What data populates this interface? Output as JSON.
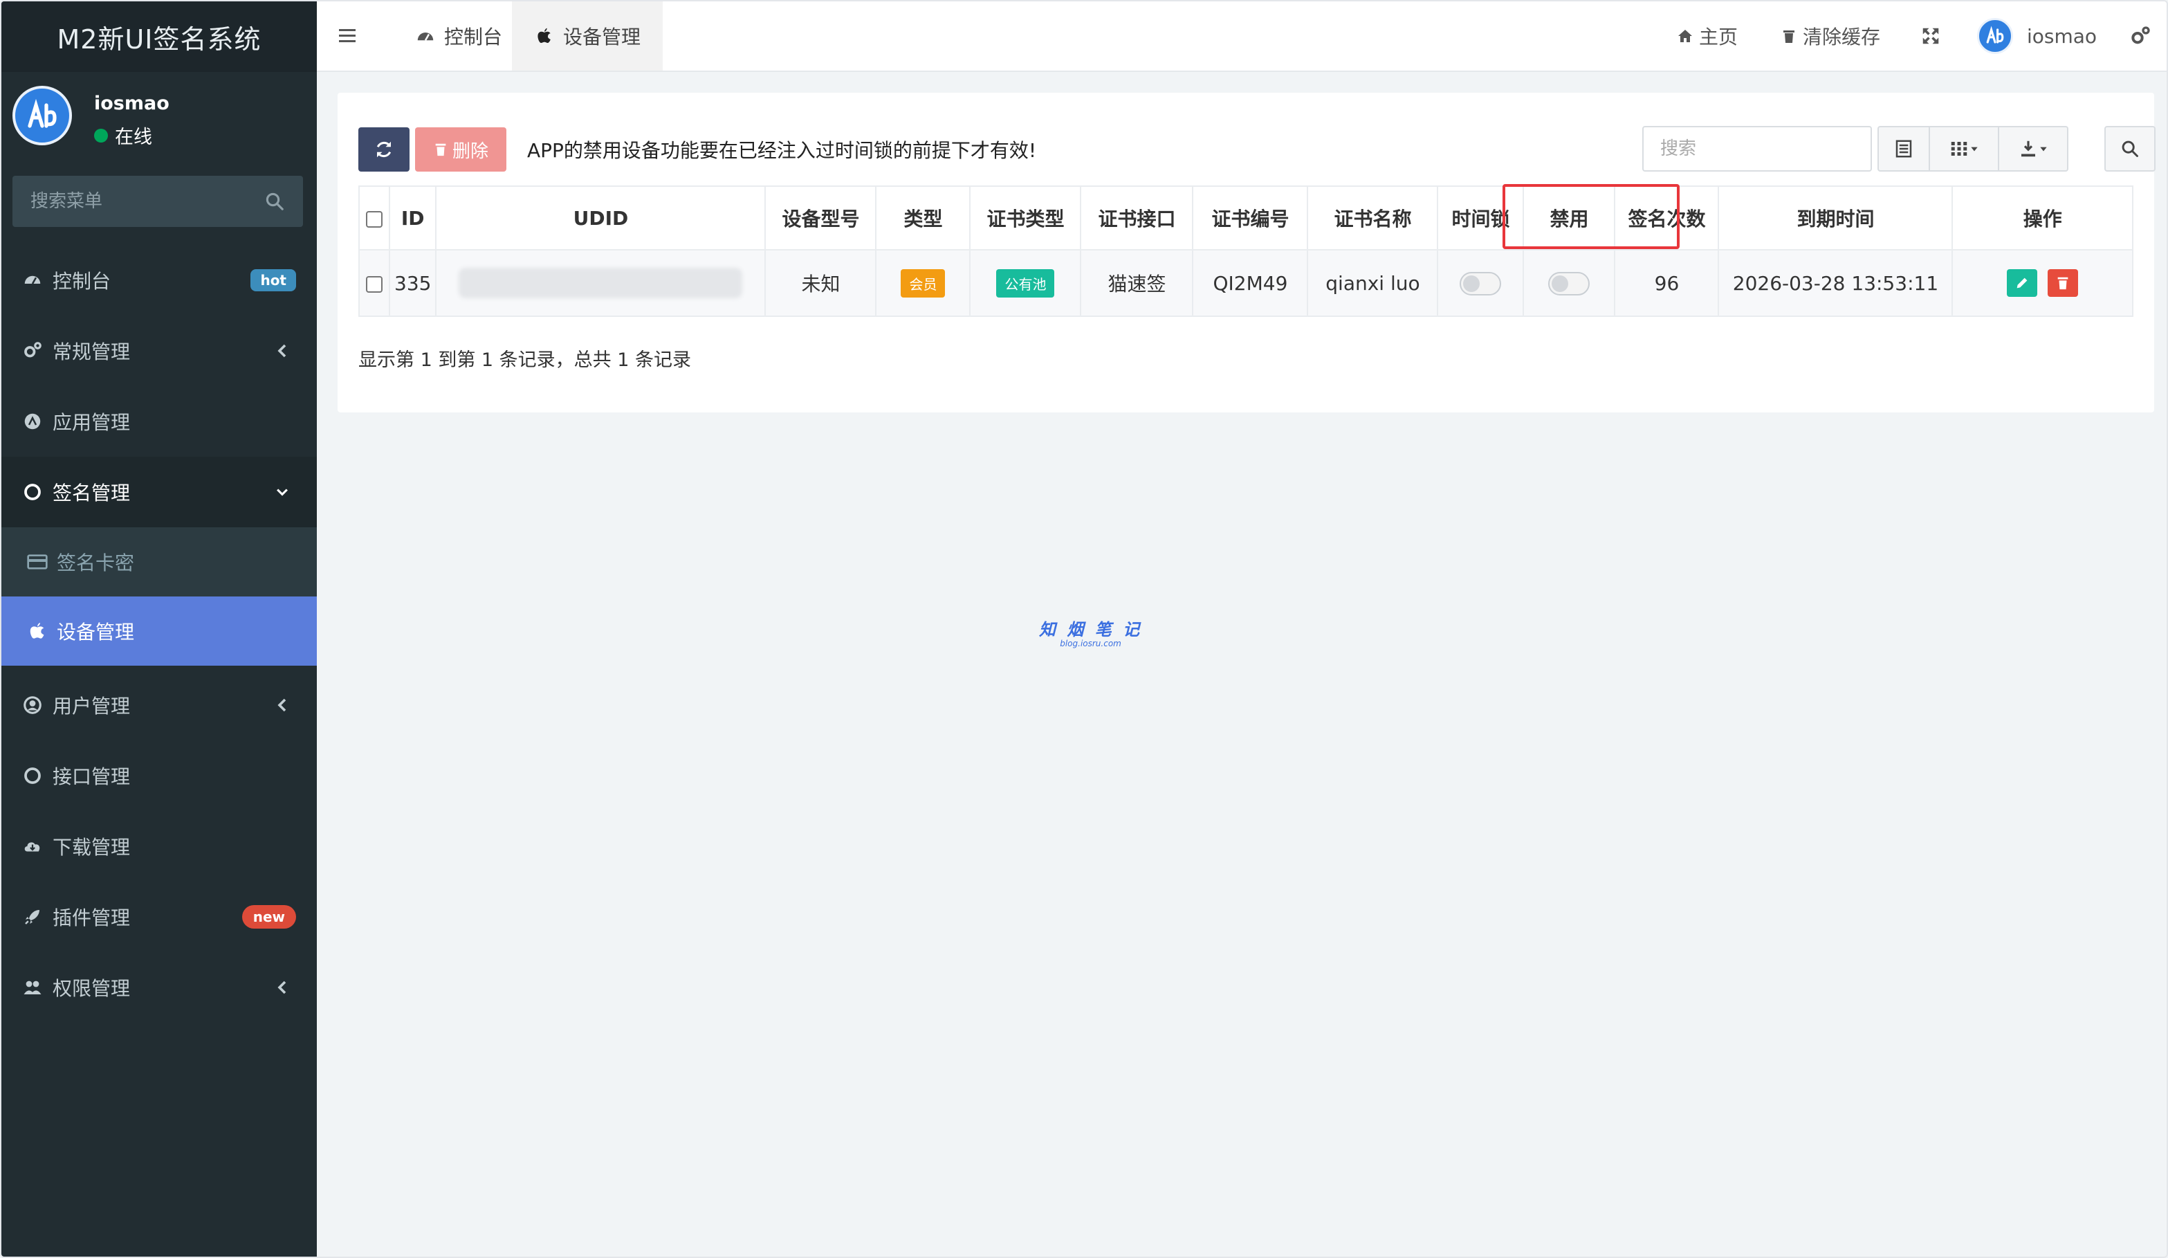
{
  "brand": "M2新UI签名系统",
  "user": {
    "name": "iosmao",
    "status": "在线"
  },
  "sidebar": {
    "search_placeholder": "搜索菜单",
    "items": [
      {
        "label": "控制台",
        "icon": "dashboard-icon",
        "badge": "hot"
      },
      {
        "label": "常规管理",
        "icon": "cogs-icon"
      },
      {
        "label": "应用管理",
        "icon": "app-store-icon"
      },
      {
        "label": "签名管理",
        "icon": "circle-icon"
      },
      {
        "label": "签名卡密",
        "icon": "credit-card-icon"
      },
      {
        "label": "设备管理",
        "icon": "apple-icon"
      },
      {
        "label": "用户管理",
        "icon": "user-circle-icon"
      },
      {
        "label": "接口管理",
        "icon": "circle-icon"
      },
      {
        "label": "下载管理",
        "icon": "cloud-download-icon"
      },
      {
        "label": "插件管理",
        "icon": "rocket-icon",
        "badge": "new"
      },
      {
        "label": "权限管理",
        "icon": "users-icon"
      }
    ]
  },
  "topbar": {
    "tabs": [
      {
        "label": "控制台",
        "icon": "dashboard-icon"
      },
      {
        "label": "设备管理",
        "icon": "apple-icon"
      }
    ],
    "home": "主页",
    "clear_cache": "清除缓存",
    "username": "iosmao"
  },
  "toolbar": {
    "delete_label": "删除",
    "notice": "APP的禁用设备功能要在已经注入过时间锁的前提下才有效!",
    "search_placeholder": "搜索"
  },
  "table": {
    "headers": [
      "ID",
      "UDID",
      "设备型号",
      "类型",
      "证书类型",
      "证书接口",
      "证书编号",
      "证书名称",
      "时间锁",
      "禁用",
      "签名次数",
      "到期时间",
      "操作"
    ],
    "rows": [
      {
        "id": "335",
        "udid": "",
        "model": "未知",
        "type": "会员",
        "cert_type": "公有池",
        "cert_api": "猫速签",
        "cert_no": "QI2M49",
        "cert_name": "qianxi luo",
        "time_lock": false,
        "disabled": false,
        "sign_count": "96",
        "expire": "2026-03-28 13:53:11"
      }
    ]
  },
  "summary": "显示第 1 到第 1 条记录，总共 1 条记录",
  "watermark": {
    "line1": "知 烟 笔 记",
    "line2": "blog.iosru.com"
  },
  "colors": {
    "sidebar_bg": "#222d32",
    "active_item": "#5b7ddb",
    "refresh_btn": "#3e4a6b",
    "delete_btn": "#f09593",
    "member_label": "#f39c12",
    "pool_label": "#18bc9c",
    "highlight_box": "#e8363b"
  }
}
